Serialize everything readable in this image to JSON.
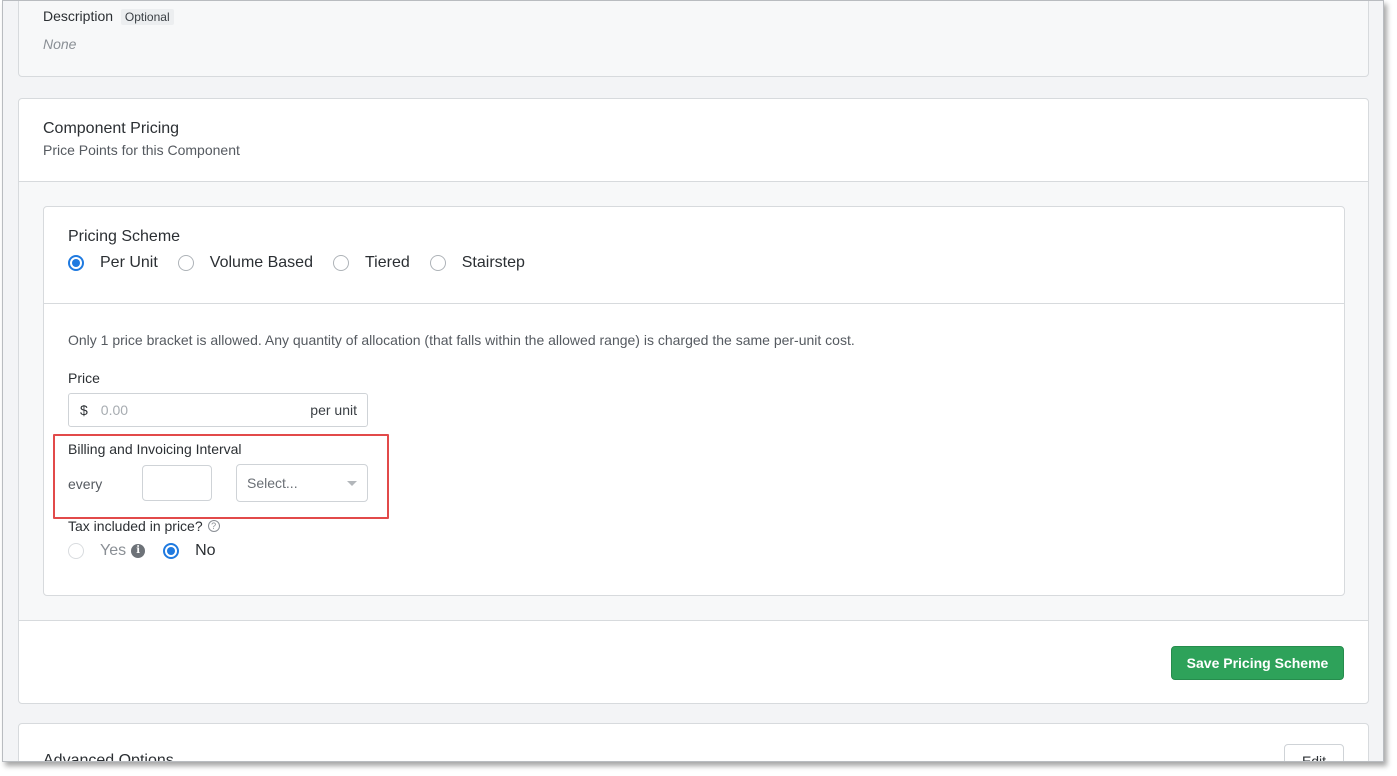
{
  "description": {
    "label": "Description",
    "badge": "Optional",
    "value": "None"
  },
  "component_pricing": {
    "title": "Component Pricing",
    "subtitle": "Price Points for this Component"
  },
  "pricing_scheme": {
    "title": "Pricing Scheme",
    "options": [
      {
        "label": "Per Unit",
        "checked": true
      },
      {
        "label": "Volume Based",
        "checked": false
      },
      {
        "label": "Tiered",
        "checked": false
      },
      {
        "label": "Stairstep",
        "checked": false
      }
    ],
    "info_text": "Only 1 price bracket is allowed. Any quantity of allocation (that falls within the allowed range) is charged the same per-unit cost."
  },
  "price": {
    "label": "Price",
    "currency": "$",
    "placeholder": "0.00",
    "unit": "per unit"
  },
  "billing": {
    "label": "Billing and Invoicing Interval",
    "every_label": "every",
    "interval_value": "",
    "select_placeholder": "Select..."
  },
  "tax": {
    "label": "Tax included in price?",
    "help_icon": "question-circle-icon",
    "yes_label": "Yes",
    "info_icon": "info-circle-icon",
    "no_label": "No",
    "selected": "No"
  },
  "actions": {
    "save_label": "Save Pricing Scheme",
    "save_color": "#2ea25a"
  },
  "advanced": {
    "title": "Advanced Options",
    "edit_label": "Edit"
  },
  "colors": {
    "accent": "#1f7ae0",
    "highlight": "#e24a4a"
  }
}
